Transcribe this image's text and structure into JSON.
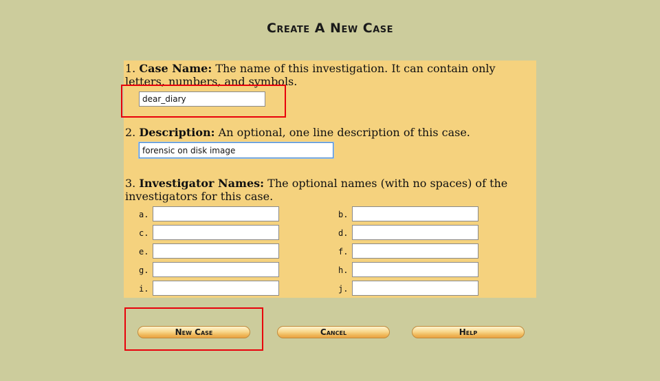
{
  "page": {
    "title": "Create A New Case"
  },
  "form": {
    "case_name": {
      "number": "1.",
      "label": "Case Name:",
      "description": "The name of this investigation. It can contain only letters, numbers, and symbols.",
      "value": "dear_diary"
    },
    "description": {
      "number": "2.",
      "label": "Description:",
      "description": "An optional, one line description of this case.",
      "value": "forensic on disk image"
    },
    "investigators": {
      "number": "3.",
      "label": "Investigator Names:",
      "description": "The optional names (with no spaces) of the investigators for this case.",
      "fields": [
        {
          "label": "a.",
          "value": ""
        },
        {
          "label": "b.",
          "value": ""
        },
        {
          "label": "c.",
          "value": ""
        },
        {
          "label": "d.",
          "value": ""
        },
        {
          "label": "e.",
          "value": ""
        },
        {
          "label": "f.",
          "value": ""
        },
        {
          "label": "g.",
          "value": ""
        },
        {
          "label": "h.",
          "value": ""
        },
        {
          "label": "i.",
          "value": ""
        },
        {
          "label": "j.",
          "value": ""
        }
      ]
    }
  },
  "buttons": {
    "new_case": "New Case",
    "cancel": "Cancel",
    "help": "Help"
  },
  "colors": {
    "background": "#cccc9c",
    "panel": "#f5d27e",
    "highlight": "#e8000a"
  }
}
